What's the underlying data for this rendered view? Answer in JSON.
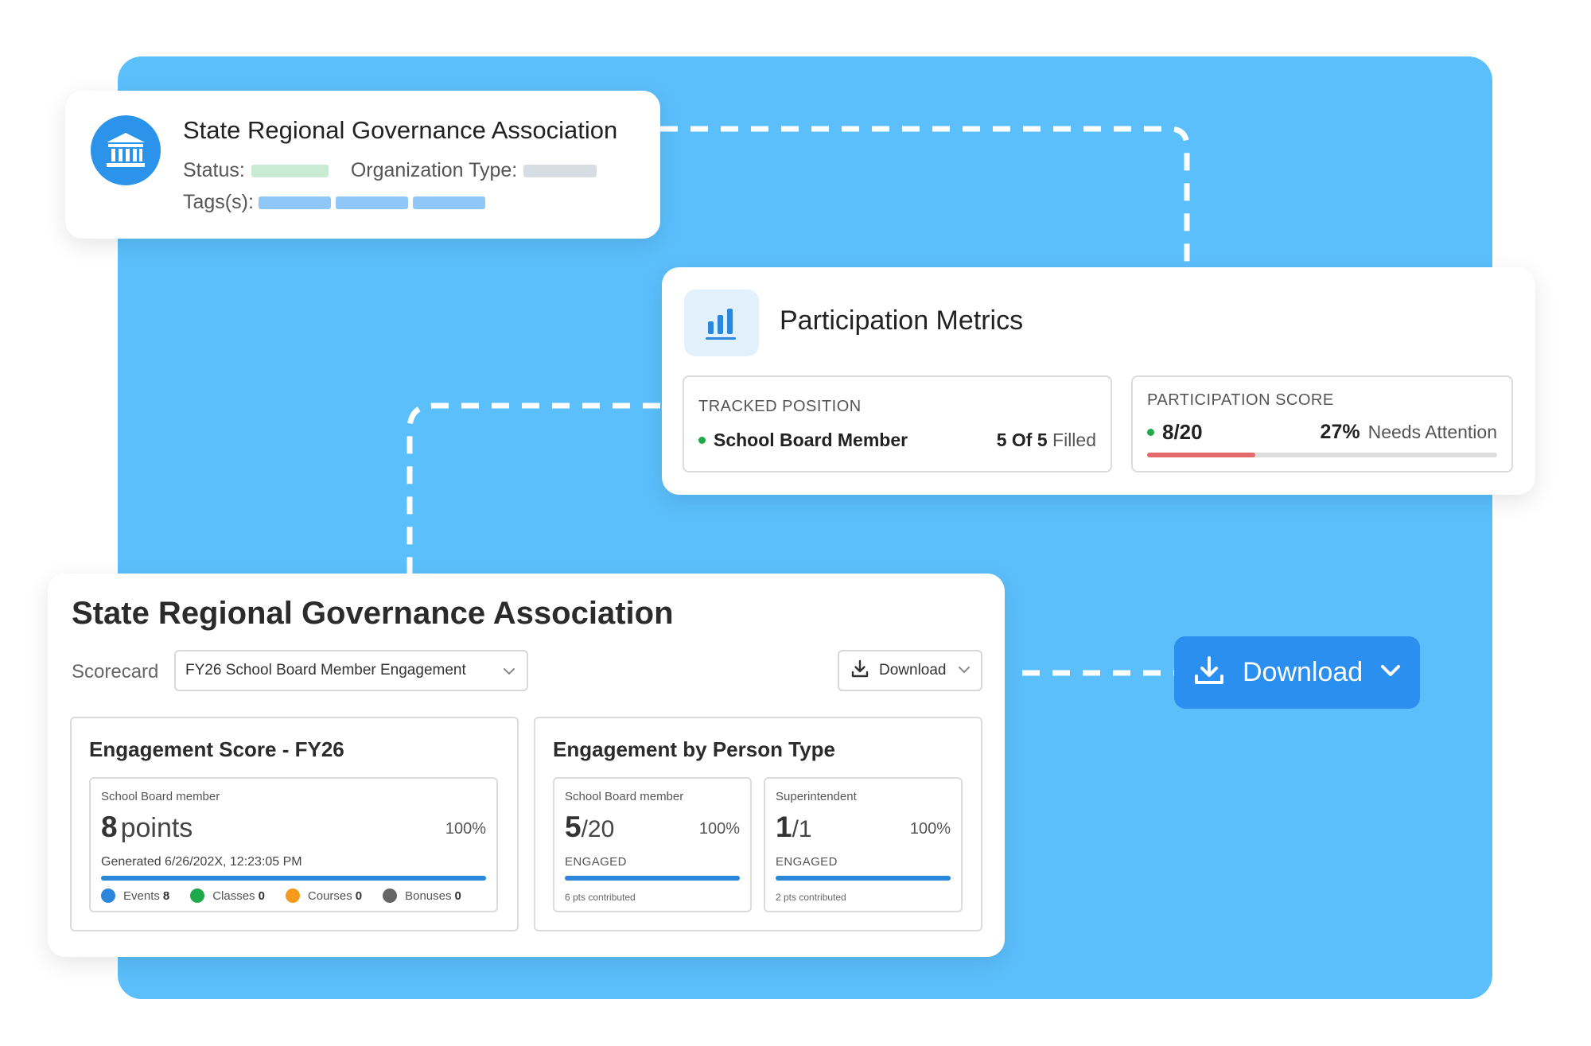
{
  "org_card": {
    "title": "State Regional Governance Association",
    "status_label": "Status:",
    "org_type_label": "Organization Type:",
    "tags_label": "Tags(s):",
    "icon": "bank-building-icon"
  },
  "metrics": {
    "title": "Participation Metrics",
    "icon": "bar-chart-icon",
    "tracked_position": {
      "label": "TRACKED POSITION",
      "position": "School Board Member",
      "filled_count": "5 Of 5",
      "filled_suffix": "Filled"
    },
    "participation_score": {
      "label": "PARTICIPATION SCORE",
      "value": "8/20",
      "percent": "27%",
      "status": "Needs Attention",
      "progress": 0.31,
      "bar_color": "#e46a6c"
    }
  },
  "download_button": {
    "label": "Download",
    "icon": "download-icon"
  },
  "scorecard": {
    "title": "State Regional Governance Association",
    "scorecard_label": "Scorecard",
    "selected": "FY26 School Board Member Engagement",
    "download_label": "Download",
    "engagement_score": {
      "title": "Engagement Score - FY26",
      "role": "School Board member",
      "points": "8",
      "points_unit": "points",
      "percent": "100%",
      "generated": "Generated 6/26/202X, 12:23:05 PM",
      "progress": 1.0,
      "legend": [
        {
          "label": "Events",
          "count": "8",
          "color": "#2b86dc"
        },
        {
          "label": "Classes",
          "count": "0",
          "color": "#1fa94b"
        },
        {
          "label": "Courses",
          "count": "0",
          "color": "#f59a1c"
        },
        {
          "label": "Bonuses",
          "count": "0",
          "color": "#666666"
        }
      ]
    },
    "by_person_type": {
      "title": "Engagement by Person Type",
      "items": [
        {
          "role": "School Board member",
          "value": "5",
          "total": "/20",
          "percent": "100%",
          "engaged": "ENGAGED",
          "contributed": "6 pts contributed",
          "progress": 1.0
        },
        {
          "role": "Superintendent",
          "value": "1",
          "total": "/1",
          "percent": "100%",
          "engaged": "ENGAGED",
          "contributed": "2 pts contributed",
          "progress": 1.0
        }
      ]
    }
  },
  "colors": {
    "background_panel": "#5bbffb",
    "accent_blue": "#2b8ff0",
    "connector": "#ffffff"
  }
}
